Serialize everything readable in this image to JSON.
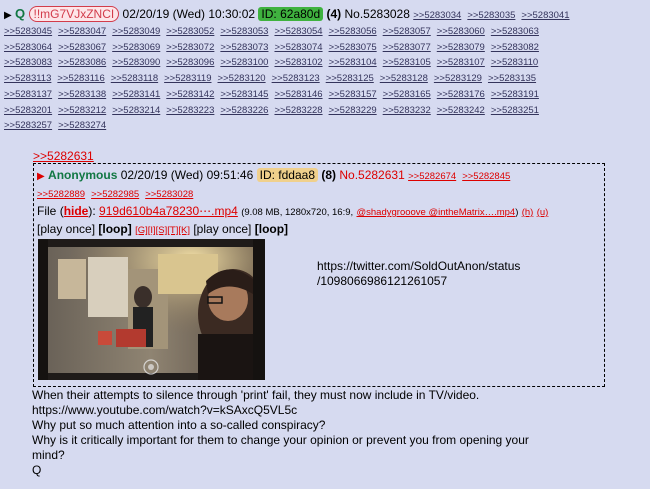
{
  "post": {
    "arrow": "▶",
    "name": "Q",
    "tripcode": "!!mG7VJxZNCI",
    "date": "02/20/19 (Wed) 10:30:02",
    "id_label": "ID: 62a80d",
    "count": "(4)",
    "number": "No.5283028",
    "backlinks": [
      ">>5283034",
      ">>5283035",
      ">>5283041",
      ">>5283045",
      ">>5283047",
      ">>5283049",
      ">>5283052",
      ">>5283053",
      ">>5283054",
      ">>5283056",
      ">>5283057",
      ">>5283060",
      ">>5283063",
      ">>5283064",
      ">>5283067",
      ">>5283069",
      ">>5283072",
      ">>5283073",
      ">>5283074",
      ">>5283075",
      ">>5283077",
      ">>5283079",
      ">>5283082",
      ">>5283083",
      ">>5283086",
      ">>5283090",
      ">>5283096",
      ">>5283100",
      ">>5283102",
      ">>5283104",
      ">>5283105",
      ">>5283107",
      ">>5283110",
      ">>5283113",
      ">>5283116",
      ">>5283118",
      ">>5283119",
      ">>5283120",
      ">>5283123",
      ">>5283125",
      ">>5283128",
      ">>5283129",
      ">>5283135",
      ">>5283137",
      ">>5283138",
      ">>5283141",
      ">>5283142",
      ">>5283145",
      ">>5283146",
      ">>5283157",
      ">>5283165",
      ">>5283176",
      ">>5283191",
      ">>5283201",
      ">>5283212",
      ">>5283214",
      ">>5283223",
      ">>5283226",
      ">>5283228",
      ">>5283229",
      ">>5283232",
      ">>5283242",
      ">>5283251",
      ">>5283257",
      ">>5283274"
    ],
    "quote_ref": ">>5282631",
    "body": [
      "When their attempts to silence through 'print' fail, they must now include in TV/video.",
      "https://www.youtube.com/watch?v=kSAxcQ5VL5c",
      "Why put so much attention into a so-called conspiracy?",
      "Why is it critically important for them to change your opinion or prevent you from opening your",
      "mind?",
      "Q"
    ]
  },
  "inline_post": {
    "arrow": "▶",
    "name": "Anonymous",
    "date": "02/20/19 (Wed) 09:51:46",
    "id_label": "ID: fddaa8",
    "count": "(8)",
    "number": "No.5282631",
    "backlinks": [
      ">>5282674",
      ">>5282845",
      ">>5282889",
      ">>5282985",
      ">>5283028"
    ],
    "file_label": "File",
    "hide_open": "(",
    "hide_label": "hide",
    "hide_close": "):",
    "file_name": "919d610b4a78230⋯.mp4",
    "file_info": "(9.08 MB, 1280x720, 16:9,",
    "file_info_link": "@shadygrooove @intheMatrix….mp4",
    "file_info_close": ")",
    "h_link": "(h)",
    "u_link": "(u)",
    "play_once": "[play once]",
    "loop": "[loop]",
    "search_links": [
      "[G]",
      "[I]",
      "[S]",
      "[T]",
      "[K]"
    ],
    "text_lines": [
      "https://twitter.com/SoldOutAnon/status",
      "/1098066986121261057"
    ]
  },
  "colors": {
    "background": "#d6daf0",
    "name_green": "#117743",
    "link_red": "#dd0000",
    "id_green": "#3fb23f",
    "id_yellow": "#f0d08c"
  }
}
